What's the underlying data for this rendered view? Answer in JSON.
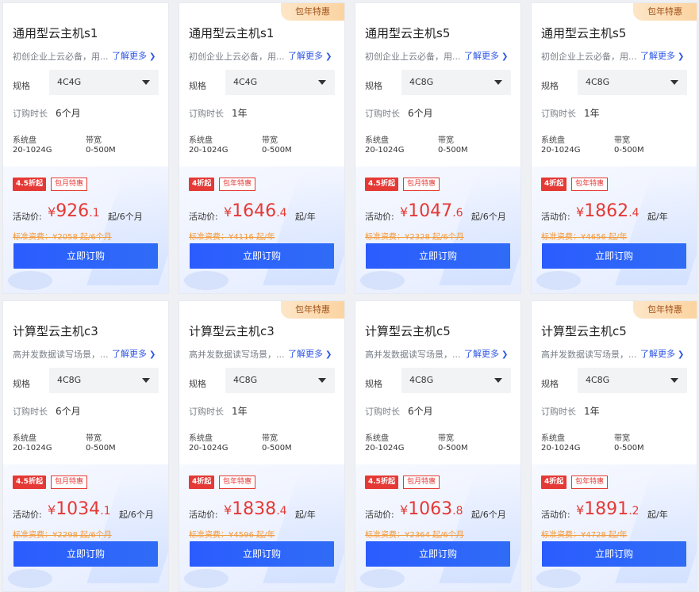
{
  "common": {
    "more_label": "了解更多",
    "spec_label": "规格",
    "term_label": "订购时长",
    "disk_label": "系统盘",
    "disk_value": "20-1024G",
    "bw_label": "带宽",
    "bw_value": "0-500M",
    "price_label": "活动价:",
    "currency": "¥",
    "buy_label": "立即订购",
    "colors": {
      "accent": "#2b5cff",
      "price": "#e53935",
      "std_price": "#f39a3a",
      "tag": "#fbd3a1"
    }
  },
  "cards": [
    {
      "title": "通用型云主机s1",
      "desc": "初创企业上云必备，用...",
      "corner_tag": "",
      "spec": "4C4G",
      "term": "6个月",
      "discount_badge": "4.5折起",
      "promo_badge": "包月特惠",
      "price_int": "926",
      "price_dec": ".1",
      "price_unit": "起/6个月",
      "std_price": "标准资费：¥2058 起/6个月"
    },
    {
      "title": "通用型云主机s1",
      "desc": "初创企业上云必备，用...",
      "corner_tag": "包年特惠",
      "spec": "4C4G",
      "term": "1年",
      "discount_badge": "4折起",
      "promo_badge": "包年特惠",
      "price_int": "1646",
      "price_dec": ".4",
      "price_unit": "起/年",
      "std_price": "标准资费：¥4116 起/年"
    },
    {
      "title": "通用型云主机s5",
      "desc": "初创企业上云必备，用...",
      "corner_tag": "",
      "spec": "4C8G",
      "term": "6个月",
      "discount_badge": "4.5折起",
      "promo_badge": "包月特惠",
      "price_int": "1047",
      "price_dec": ".6",
      "price_unit": "起/6个月",
      "std_price": "标准资费：¥2328 起/6个月"
    },
    {
      "title": "通用型云主机s5",
      "desc": "初创企业上云必备，用...",
      "corner_tag": "包年特惠",
      "spec": "4C8G",
      "term": "1年",
      "discount_badge": "4折起",
      "promo_badge": "包年特惠",
      "price_int": "1862",
      "price_dec": ".4",
      "price_unit": "起/年",
      "std_price": "标准资费：¥4656 起/年"
    },
    {
      "title": "计算型云主机c3",
      "desc": "高并发数据读写场景，...",
      "corner_tag": "",
      "spec": "4C8G",
      "term": "6个月",
      "discount_badge": "4.5折起",
      "promo_badge": "包月特惠",
      "price_int": "1034",
      "price_dec": ".1",
      "price_unit": "起/6个月",
      "std_price": "标准资费：¥2298 起/6个月"
    },
    {
      "title": "计算型云主机c3",
      "desc": "高并发数据读写场景，...",
      "corner_tag": "包年特惠",
      "spec": "4C8G",
      "term": "1年",
      "discount_badge": "4折起",
      "promo_badge": "包年特惠",
      "price_int": "1838",
      "price_dec": ".4",
      "price_unit": "起/年",
      "std_price": "标准资费：¥4596 起/年"
    },
    {
      "title": "计算型云主机c5",
      "desc": "高并发数据读写场景，...",
      "corner_tag": "",
      "spec": "4C8G",
      "term": "6个月",
      "discount_badge": "4.5折起",
      "promo_badge": "包月特惠",
      "price_int": "1063",
      "price_dec": ".8",
      "price_unit": "起/6个月",
      "std_price": "标准资费：¥2364 起/6个月"
    },
    {
      "title": "计算型云主机c5",
      "desc": "高并发数据读写场景，...",
      "corner_tag": "包年特惠",
      "spec": "4C8G",
      "term": "1年",
      "discount_badge": "4折起",
      "promo_badge": "包年特惠",
      "price_int": "1891",
      "price_dec": ".2",
      "price_unit": "起/年",
      "std_price": "标准资费：¥4728 起/年"
    }
  ]
}
